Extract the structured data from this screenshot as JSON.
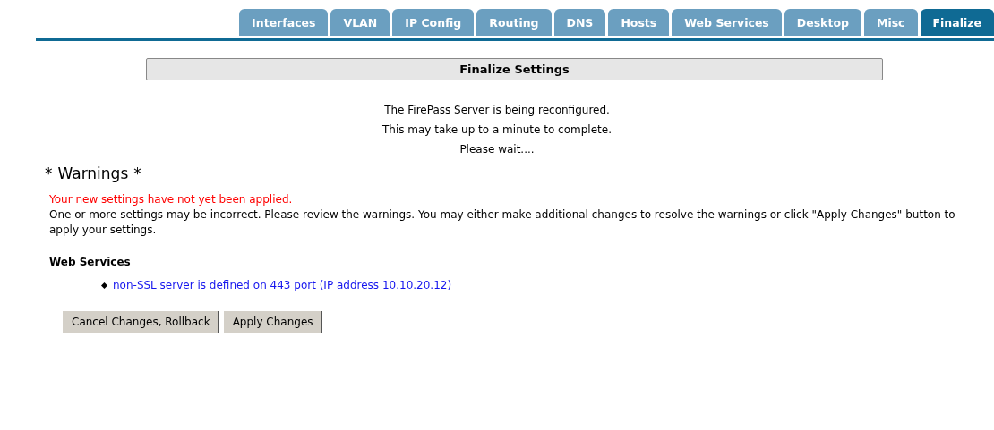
{
  "tabs": [
    {
      "label": "Interfaces",
      "selected": false
    },
    {
      "label": "VLAN",
      "selected": false
    },
    {
      "label": "IP Config",
      "selected": false
    },
    {
      "label": "Routing",
      "selected": false
    },
    {
      "label": "DNS",
      "selected": false
    },
    {
      "label": "Hosts",
      "selected": false
    },
    {
      "label": "Web Services",
      "selected": false
    },
    {
      "label": "Desktop",
      "selected": false
    },
    {
      "label": "Misc",
      "selected": false
    },
    {
      "label": "Finalize",
      "selected": true
    }
  ],
  "section_title": "Finalize Settings",
  "status_lines": [
    "The FirePass Server is being reconfigured.",
    "This may take up to a minute to complete.",
    "Please wait...."
  ],
  "warnings": {
    "heading_prefix": "*",
    "heading": "Warnings",
    "heading_suffix": "*",
    "alert": "Your new settings have not yet been applied.",
    "message": "One or more settings may be incorrect. Please review the warnings. You may either make additional changes to resolve the warnings or click \"Apply Changes\" button to apply your settings.",
    "groups": [
      {
        "title": "Web Services",
        "items": [
          "non-SSL server is defined on 443 port (IP address 10.10.20.12)"
        ]
      }
    ]
  },
  "buttons": [
    "Cancel Changes, Rollback",
    "Apply Changes"
  ]
}
